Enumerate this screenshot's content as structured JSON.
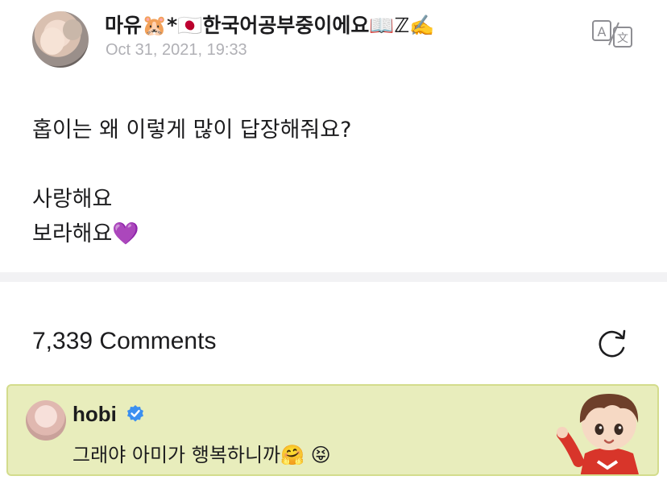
{
  "post": {
    "author_name": "마유🐹*🇯🇵한국어공부중이에요📖ℤ✍️",
    "timestamp": "Oct 31, 2021, 19:33",
    "body_lines": [
      "홉이는 왜 이렇게 많이 답장해줘요?",
      "",
      "사랑해요",
      "보라해요💜"
    ]
  },
  "comments": {
    "count_label": "7,339 Comments"
  },
  "reply": {
    "author_name": "hobi",
    "text": "그래야 아미가 행복하니까🤗 😝"
  },
  "icons": {
    "translate": "translate-icon",
    "refresh": "refresh-icon",
    "verified": "verified-badge-icon"
  },
  "colors": {
    "reply_background": "#e8edbc",
    "reply_border": "#d3dc8c",
    "verified_blue": "#3b8ff0",
    "timestamp_gray": "#b0b0b5"
  }
}
